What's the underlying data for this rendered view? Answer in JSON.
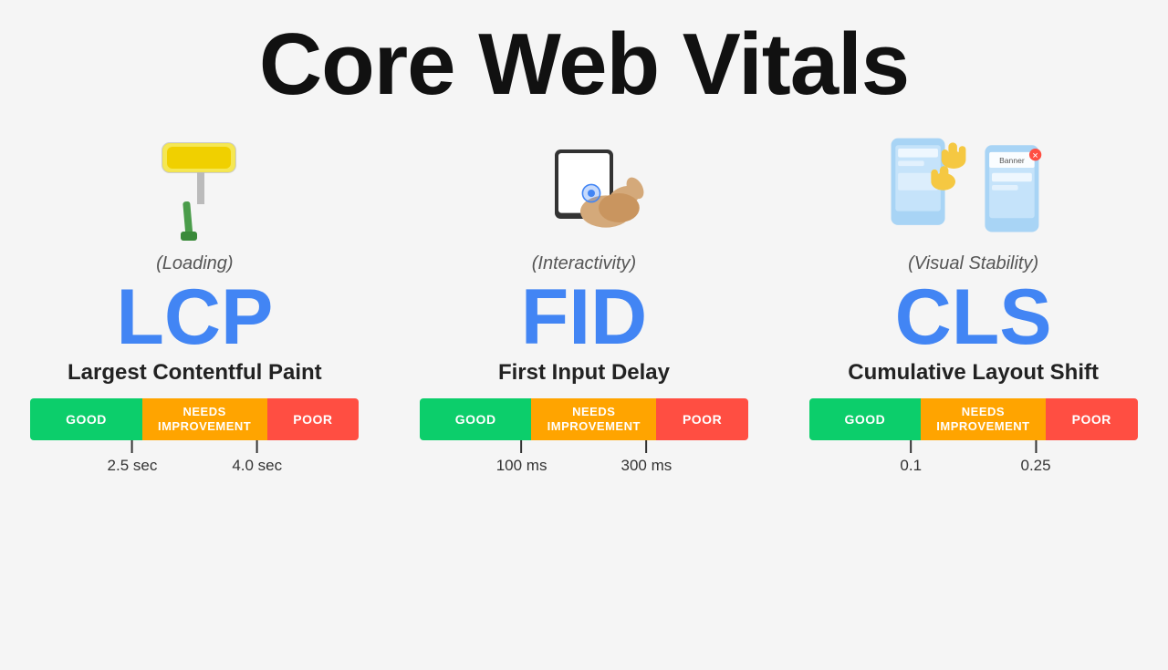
{
  "page": {
    "title": "Core Web Vitals",
    "bg_color": "#f5f5f5"
  },
  "vitals": [
    {
      "id": "lcp",
      "category": "(Loading)",
      "acronym": "LCP",
      "name": "Largest Contentful Paint",
      "bar": {
        "good_label": "GOOD",
        "needs_label": "NEEDS\nIMPROVEMENT",
        "poor_label": "POOR",
        "good_width": "34%",
        "needs_width": "38%",
        "poor_width": "28%"
      },
      "thresholds": [
        {
          "label": "2.5 sec",
          "left": "31%"
        },
        {
          "label": "4.0 sec",
          "left": "69%"
        }
      ]
    },
    {
      "id": "fid",
      "category": "(Interactivity)",
      "acronym": "FID",
      "name": "First Input Delay",
      "bar": {
        "good_label": "GOOD",
        "needs_label": "NEEDS\nIMPROVEMENT",
        "poor_label": "POOR",
        "good_width": "34%",
        "needs_width": "38%",
        "poor_width": "28%"
      },
      "thresholds": [
        {
          "label": "100 ms",
          "left": "31%"
        },
        {
          "label": "300 ms",
          "left": "69%"
        }
      ]
    },
    {
      "id": "cls",
      "category": "(Visual Stability)",
      "acronym": "CLS",
      "name": "Cumulative Layout Shift",
      "bar": {
        "good_label": "GOOD",
        "needs_label": "NEEDS\nIMPROVEMENT",
        "poor_label": "POOR",
        "good_width": "34%",
        "needs_width": "38%",
        "poor_width": "28%"
      },
      "thresholds": [
        {
          "label": "0.1",
          "left": "31%"
        },
        {
          "label": "0.25",
          "left": "69%"
        }
      ]
    }
  ]
}
